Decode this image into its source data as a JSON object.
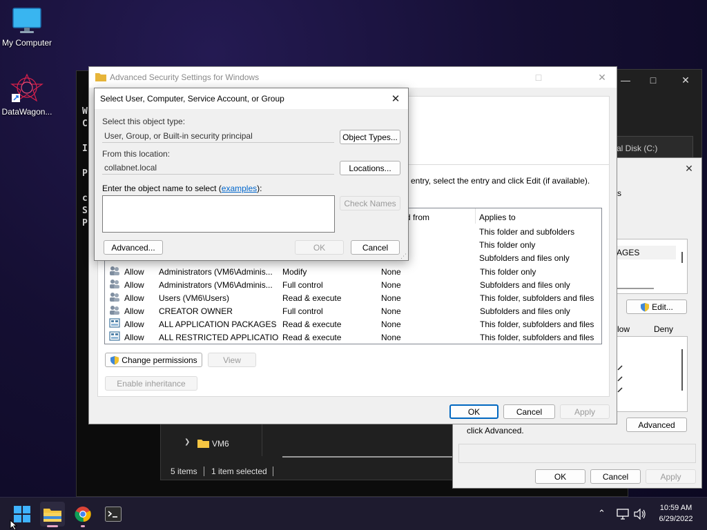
{
  "desktop": {
    "icons": [
      {
        "label": "My Computer"
      },
      {
        "label": "DataWagon..."
      }
    ]
  },
  "terminal": {
    "letters": [
      "W",
      "C",
      "I",
      "P",
      "c",
      "S",
      "P"
    ]
  },
  "explorer": {
    "tree_item": "VM6",
    "status_items": "5 items",
    "status_selected": "1 item selected",
    "drive_label": "cal Disk (C:)"
  },
  "props_dialog": {
    "tab_fragment": "s",
    "list_item": "AGES",
    "edit_label": "Edit...",
    "col_allow": "low",
    "col_deny": "Deny",
    "advanced_label": "Advanced",
    "advanced_text": "click Advanced.",
    "ok": "OK",
    "cancel": "Cancel",
    "apply": "Apply"
  },
  "advanced": {
    "title": "Advanced Security Settings for Windows",
    "instruction": "entry, select the entry and click Edit (if available).",
    "columns": {
      "inherited": "d from",
      "applies": "Applies to"
    },
    "entries_top": [
      {
        "applies": "This folder and subfolders"
      },
      {
        "applies": "This folder only"
      },
      {
        "applies": "Subfolders and files only"
      }
    ],
    "entries": [
      {
        "type": "Allow",
        "principal": "Administrators (VM6\\Adminis...",
        "access": "Modify",
        "inherited": "None",
        "applies": "This folder only"
      },
      {
        "type": "Allow",
        "principal": "Administrators (VM6\\Adminis...",
        "access": "Full control",
        "inherited": "None",
        "applies": "Subfolders and files only"
      },
      {
        "type": "Allow",
        "principal": "Users (VM6\\Users)",
        "access": "Read & execute",
        "inherited": "None",
        "applies": "This folder, subfolders and files"
      },
      {
        "type": "Allow",
        "principal": "CREATOR OWNER",
        "access": "Full control",
        "inherited": "None",
        "applies": "Subfolders and files only"
      },
      {
        "type": "Allow",
        "principal": "ALL APPLICATION PACKAGES",
        "access": "Read & execute",
        "inherited": "None",
        "applies": "This folder, subfolders and files"
      },
      {
        "type": "Allow",
        "principal": "ALL RESTRICTED APPLICATIO...",
        "access": "Read & execute",
        "inherited": "None",
        "applies": "This folder, subfolders and files"
      }
    ],
    "change_permissions": "Change permissions",
    "view": "View",
    "enable_inheritance": "Enable inheritance",
    "ok": "OK",
    "cancel": "Cancel",
    "apply": "Apply"
  },
  "select_dialog": {
    "title": "Select User, Computer, Service Account, or Group",
    "object_type_label": "Select this object type:",
    "object_type_value": "User, Group, or Built-in security principal",
    "object_types_btn": "Object Types...",
    "location_label": "From this location:",
    "location_value": "collabnet.local",
    "locations_btn": "Locations...",
    "name_label_prefix": "Enter the object name to select (",
    "name_label_link": "examples",
    "name_label_suffix": "):",
    "check_names": "Check Names",
    "advanced": "Advanced...",
    "ok": "OK",
    "cancel": "Cancel"
  },
  "taskbar": {
    "time": "10:59 AM",
    "date": "6/29/2022"
  },
  "colors": {
    "accent": "#0067c0",
    "link": "#0066cc"
  }
}
